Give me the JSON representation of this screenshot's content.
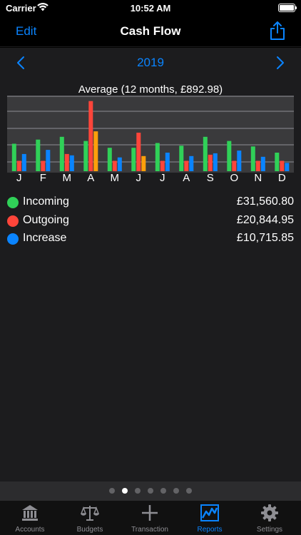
{
  "status": {
    "carrier": "Carrier",
    "time": "10:52 AM"
  },
  "nav": {
    "edit_label": "Edit",
    "title": "Cash Flow"
  },
  "year": {
    "label": "2019"
  },
  "chart_data": {
    "type": "bar",
    "title": "Average (12 months, £892.98)",
    "categories": [
      "J",
      "F",
      "M",
      "A",
      "M",
      "J",
      "J",
      "A",
      "S",
      "O",
      "N",
      "D"
    ],
    "series": [
      {
        "name": "Incoming",
        "color": "#30d158",
        "values": [
          40,
          46,
          50,
          44,
          34,
          34,
          41,
          37,
          50,
          44,
          36,
          27
        ]
      },
      {
        "name": "Outgoing",
        "color": "#ff453a",
        "values": [
          15,
          15,
          25,
          102,
          15,
          56,
          15,
          15,
          24,
          15,
          15,
          15
        ]
      },
      {
        "name": "Increase",
        "color": "#0a84ff",
        "values": [
          25,
          31,
          23,
          0,
          20,
          0,
          27,
          22,
          26,
          30,
          21,
          12
        ]
      },
      {
        "name": "",
        "color": "#ff9f0a",
        "values": [
          0,
          0,
          0,
          58,
          0,
          22,
          0,
          0,
          0,
          0,
          0,
          0
        ]
      }
    ],
    "ylim": [
      0,
      110
    ],
    "grid": true
  },
  "legend": [
    {
      "label": "Incoming",
      "value": "£31,560.80",
      "color": "#30d158"
    },
    {
      "label": "Outgoing",
      "value": "£20,844.95",
      "color": "#ff453a"
    },
    {
      "label": "Increase",
      "value": "£10,715.85",
      "color": "#0a84ff"
    }
  ],
  "page_indicator": {
    "count": 7,
    "active": 1
  },
  "tabs": [
    {
      "label": "Accounts",
      "icon": "bank-icon"
    },
    {
      "label": "Budgets",
      "icon": "scales-icon"
    },
    {
      "label": "Transaction",
      "icon": "plus-icon"
    },
    {
      "label": "Reports",
      "icon": "chart-icon",
      "active": true
    },
    {
      "label": "Settings",
      "icon": "gear-icon"
    }
  ]
}
